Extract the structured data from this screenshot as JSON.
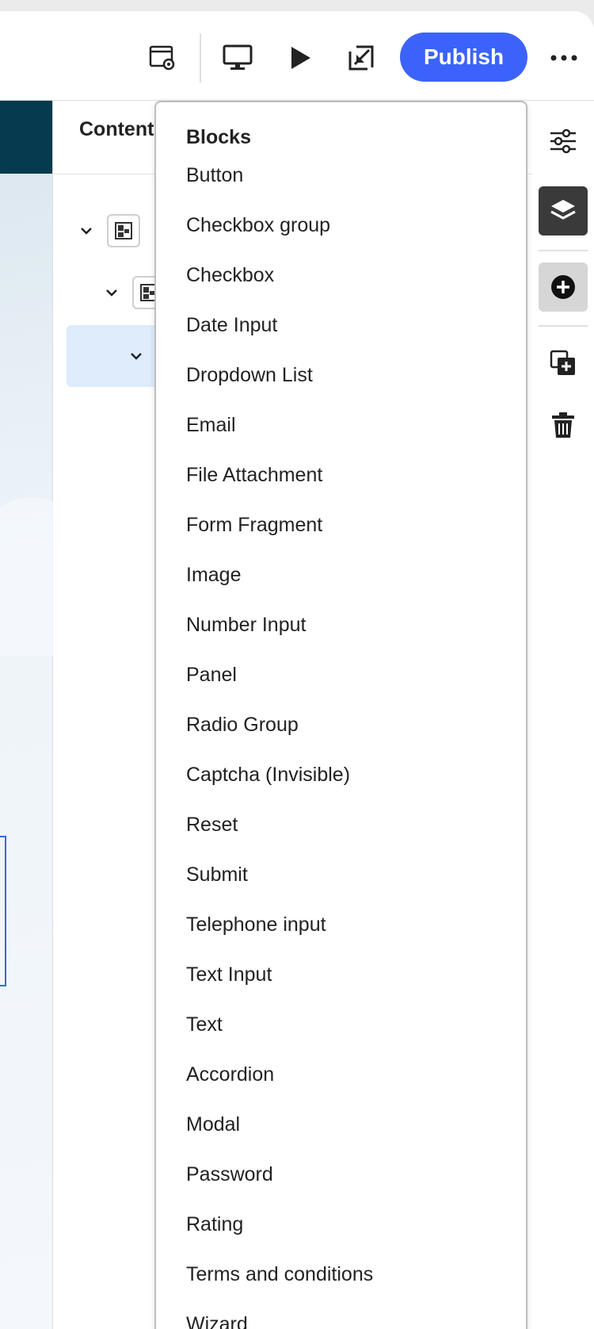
{
  "header": {
    "publish_label": "Publish",
    "icons": [
      "form-properties-icon",
      "desktop-preview-icon",
      "play-icon",
      "open-in-new-icon",
      "more-icon"
    ]
  },
  "content_panel": {
    "title": "Content"
  },
  "blocks_menu": {
    "heading": "Blocks",
    "items": [
      "Button",
      "Checkbox group",
      "Checkbox",
      "Date Input",
      "Dropdown List",
      "Email",
      "File Attachment",
      "Form Fragment",
      "Image",
      "Number Input",
      "Panel",
      "Radio Group",
      "Captcha (Invisible)",
      "Reset",
      "Submit",
      "Telephone input",
      "Text Input",
      "Text",
      "Accordion",
      "Modal",
      "Password",
      "Rating",
      "Terms and conditions",
      "Wizard"
    ]
  },
  "rail": {
    "icons": [
      "properties-icon",
      "content-tree-icon",
      "add-icon",
      "duplicate-icon",
      "delete-icon"
    ]
  },
  "colors": {
    "accent": "#3b63fb",
    "banner": "#053a4f",
    "selected_row": "#deecfb",
    "active_rail": "#3a3a3a"
  }
}
